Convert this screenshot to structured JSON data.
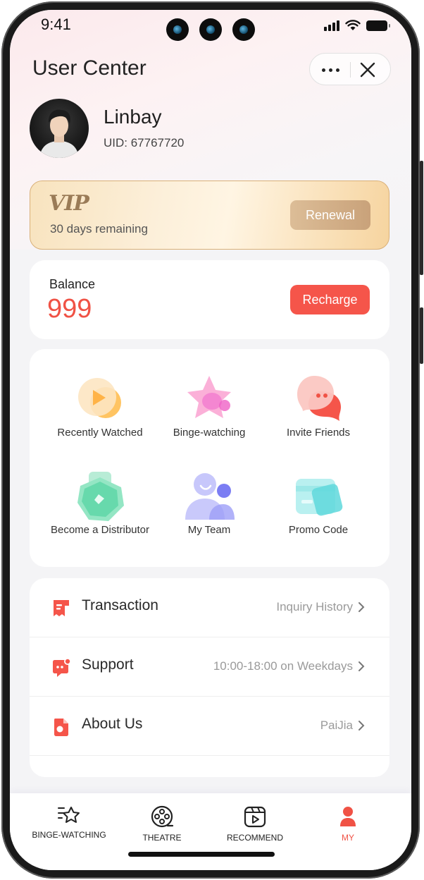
{
  "status_bar": {
    "time": "9:41"
  },
  "header": {
    "title": "User Center"
  },
  "profile": {
    "name": "Linbay",
    "uid": "UID: 67767720"
  },
  "vip": {
    "logo": "VIP",
    "remaining": "30 days remaining",
    "renewal_label": "Renewal"
  },
  "balance": {
    "label": "Balance",
    "value": "999",
    "recharge_label": "Recharge"
  },
  "features": [
    {
      "label": "Recently Watched",
      "icon": "play-icon"
    },
    {
      "label": "Binge-watching",
      "icon": "star-icon"
    },
    {
      "label": "Invite Friends",
      "icon": "chat-bubble-icon"
    },
    {
      "label": "Become a Distributor",
      "icon": "hexagon-icon"
    },
    {
      "label": "My Team",
      "icon": "team-icon"
    },
    {
      "label": "Promo Code",
      "icon": "card-icon"
    }
  ],
  "menu": [
    {
      "title": "Transaction",
      "value": "Inquiry History",
      "icon": "receipt-icon"
    },
    {
      "title": "Support",
      "value": "10:00-18:00 on Weekdays",
      "icon": "support-chat-icon"
    },
    {
      "title": "About Us",
      "value": "PaiJia",
      "icon": "document-icon"
    }
  ],
  "tabbar": {
    "items": [
      {
        "label": "BINGE-WATCHING",
        "icon": "star-list-icon"
      },
      {
        "label": "THEATRE",
        "icon": "film-reel-icon"
      },
      {
        "label": "RECOMMEND",
        "icon": "video-play-icon"
      },
      {
        "label": "MY",
        "icon": "user-icon"
      }
    ],
    "active": "MY"
  },
  "colors": {
    "accent": "#f05245",
    "vip_gold": "#c9a27a",
    "background": "#f4f4f6"
  }
}
